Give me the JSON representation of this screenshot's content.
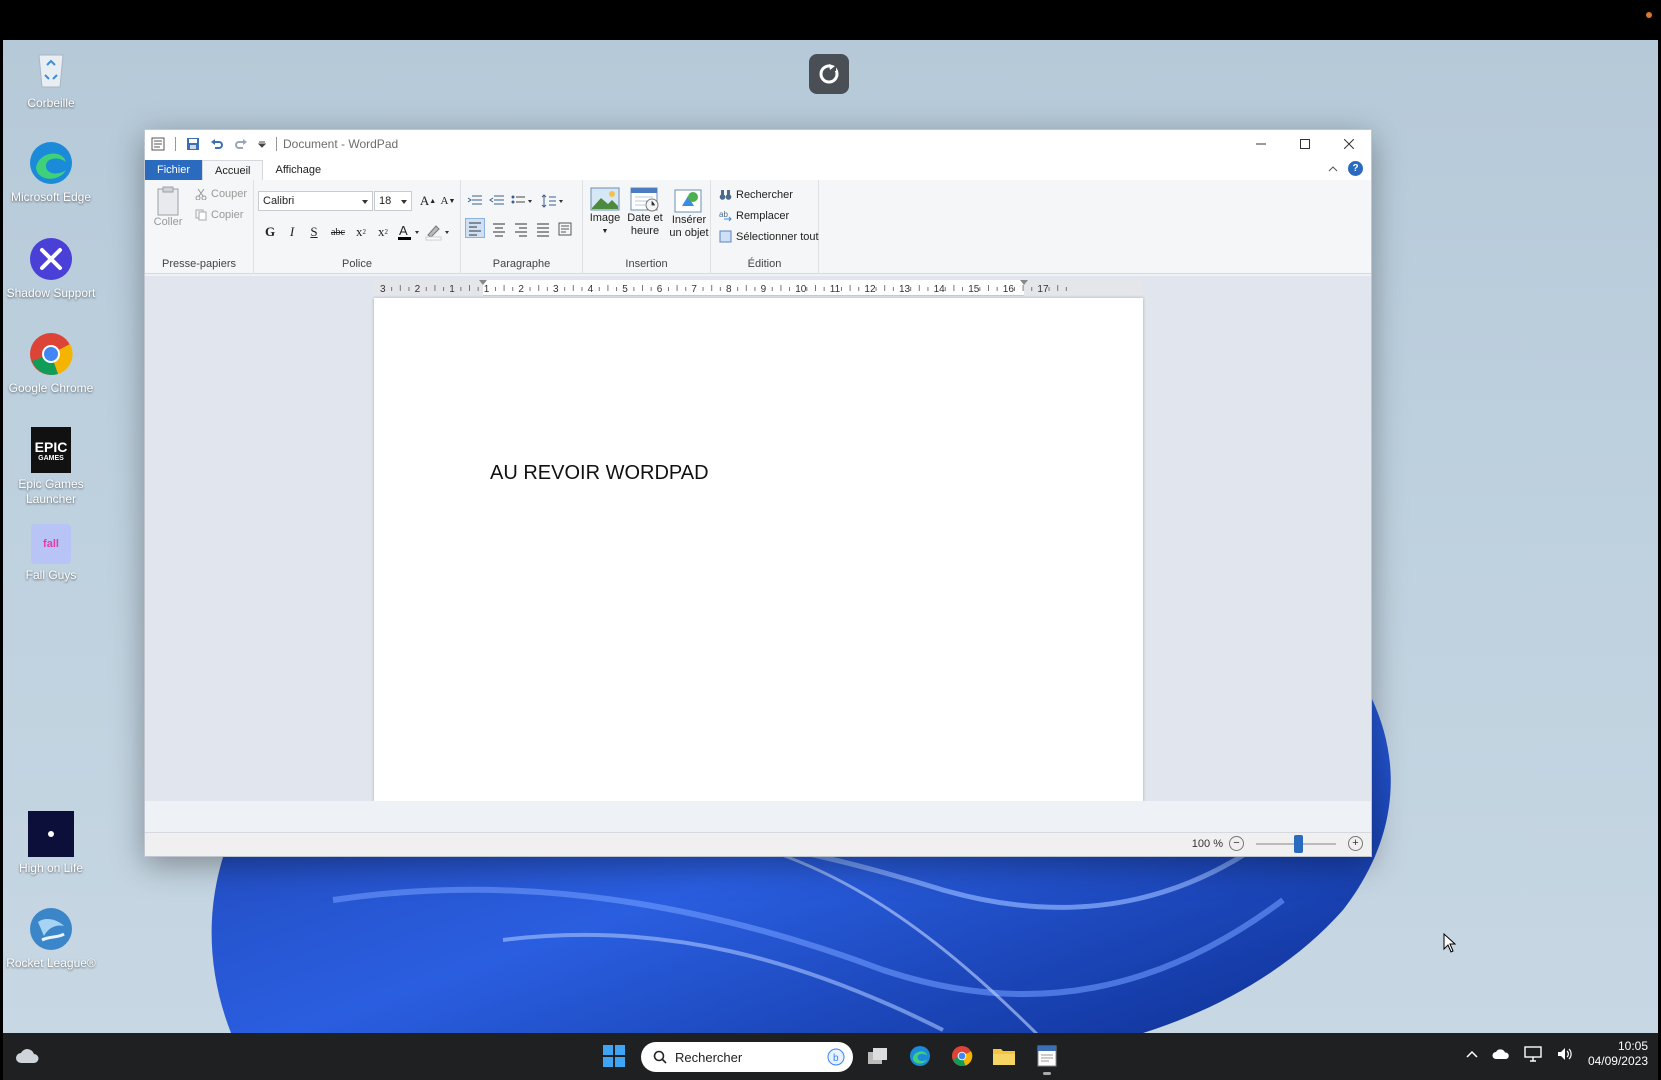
{
  "desktop": {
    "icons": [
      {
        "label": "Corbeille",
        "icon": "recycle-bin-icon"
      },
      {
        "label": "Microsoft Edge",
        "icon": "edge-icon"
      },
      {
        "label": "Shadow Support",
        "icon": "tools-icon"
      },
      {
        "label": "Google Chrome",
        "icon": "chrome-icon"
      },
      {
        "label": "Epic Games Launcher",
        "icon": "epic-games-icon"
      },
      {
        "label": "Fall Guys",
        "icon": "fall-guys-icon"
      },
      {
        "label": "High on Life",
        "icon": "high-on-life-icon"
      },
      {
        "label": "Rocket League®",
        "icon": "rocket-league-icon"
      }
    ],
    "epic_logo_text": "EPIC",
    "epic_logo_sub": "GAMES",
    "fall_guys_text": "fall"
  },
  "window": {
    "title": "Document - WordPad",
    "tabs": {
      "file": "Fichier",
      "home": "Accueil",
      "view": "Affichage"
    },
    "ribbon": {
      "clipboard": {
        "paste": "Coller",
        "cut": "Couper",
        "copy": "Copier",
        "group": "Presse-papiers"
      },
      "font": {
        "family": "Calibri",
        "size": "18",
        "bold": "G",
        "italic": "I",
        "underline": "S",
        "strike": "abc",
        "group": "Police"
      },
      "paragraph": {
        "group": "Paragraphe"
      },
      "insert": {
        "image": "Image",
        "datetime_1": "Date et",
        "datetime_2": "heure",
        "object_1": "Insérer",
        "object_2": "un objet",
        "group": "Insertion"
      },
      "edit": {
        "find": "Rechercher",
        "replace": "Remplacer",
        "select_all": "Sélectionner tout",
        "group": "Édition"
      }
    },
    "ruler_labels": [
      "3",
      "2",
      "1",
      "1",
      "2",
      "3",
      "4",
      "5",
      "6",
      "7",
      "8",
      "9",
      "10",
      "11",
      "12",
      "13",
      "14",
      "15",
      "16",
      "17"
    ],
    "document_text": "AU REVOIR WORDPAD",
    "zoom_label": "100 %",
    "zoom_level": 1.0
  },
  "taskbar": {
    "search_placeholder": "Rechercher",
    "time": "10:05",
    "date": "04/09/2023"
  },
  "colors": {
    "accent": "#2b6bbf",
    "taskbar": "#1f2022"
  }
}
